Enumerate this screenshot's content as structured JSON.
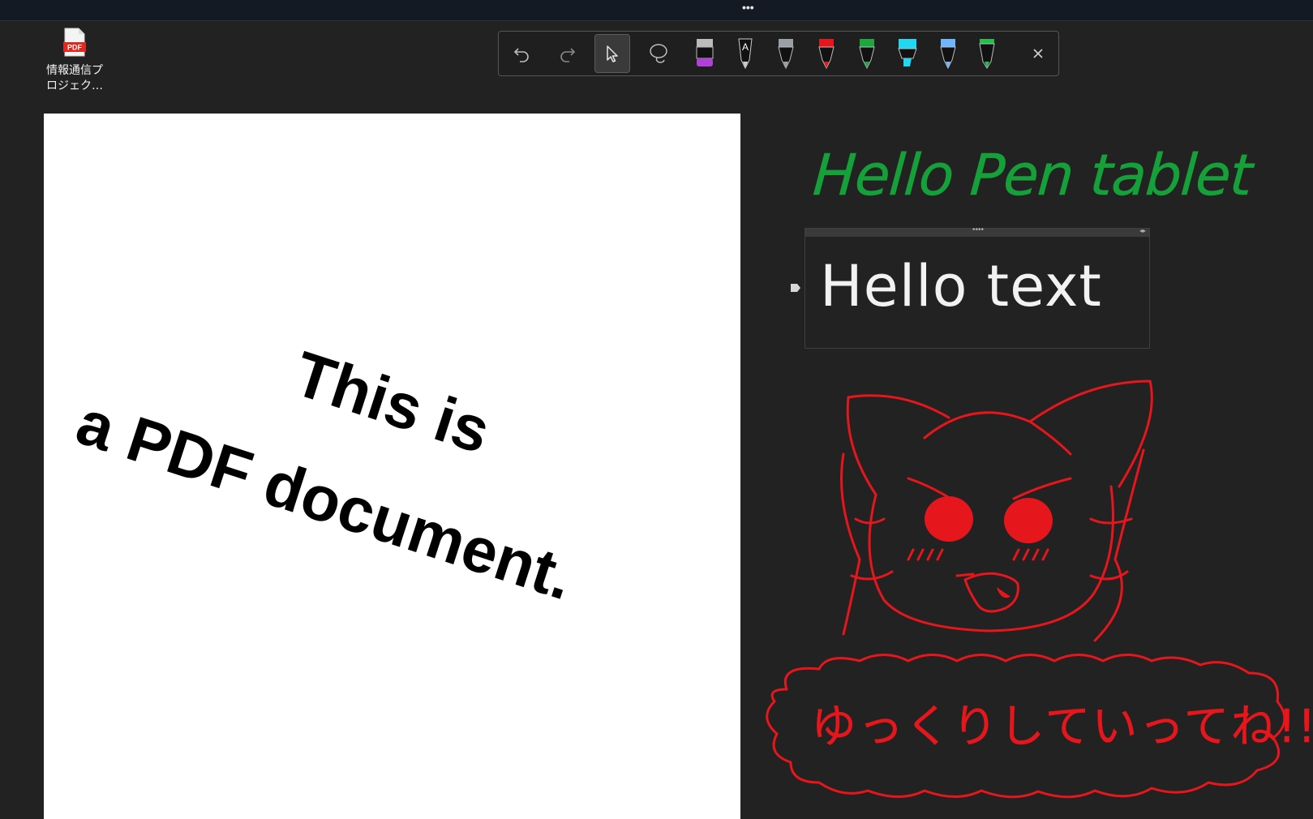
{
  "titlebar": {
    "menu_dots": "•••"
  },
  "desktop_file": {
    "icon_label": "PDF",
    "name": "情報通信プ\nロジェク…"
  },
  "toolbar": {
    "tools": [
      "undo-icon",
      "redo-icon",
      "select-icon",
      "lasso-icon",
      "purple-eraser-pen",
      "gray-text-pen",
      "gray-pen",
      "red-pen",
      "green-pen",
      "cyan-highlighter",
      "blue-fountain-pen",
      "green-highlighter",
      "close-icon"
    ],
    "pen_colors": [
      "#b23fd6",
      "#ffffff",
      "#9aa0a6",
      "#e5161c",
      "#1ea540",
      "#23d7f0",
      "#6fb6ff",
      "#22c04a"
    ]
  },
  "pdf": {
    "line1": "This is",
    "line2": "a PDF document."
  },
  "handwriting": {
    "green_text": "Hello Pen tablet",
    "red_text": "ゆっくりしていってね!!",
    "green_color": "#16a03a",
    "red_color": "#e5161c"
  },
  "textbox": {
    "content": "Hello text",
    "grip": "••••",
    "arrows": "◂▸"
  }
}
